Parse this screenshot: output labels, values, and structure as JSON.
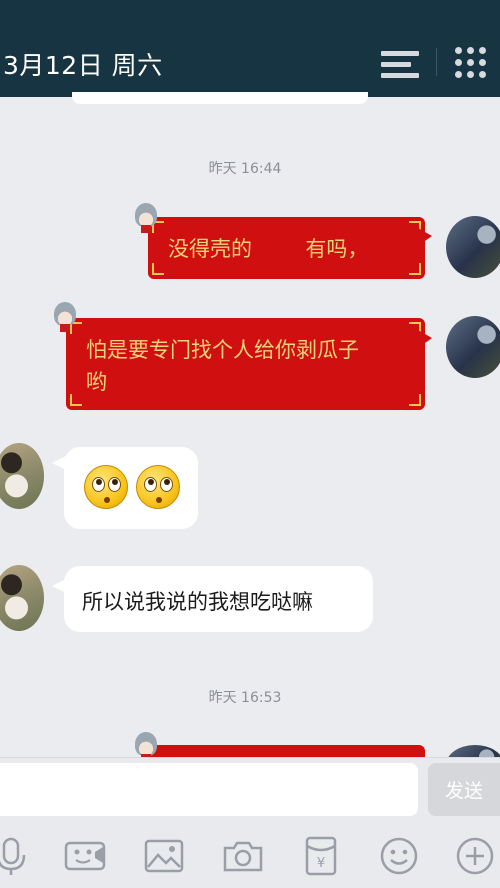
{
  "header": {
    "title": "3月12日  周六"
  },
  "chat": {
    "messages": [
      {
        "type": "timestamp",
        "text": "昨天 16:44"
      },
      {
        "type": "outgoing_redpacket",
        "text": "没得壳的        有吗，"
      },
      {
        "type": "outgoing_redpacket",
        "line1": "怕是要专门找个人给你剥瓜子",
        "line2": "哟"
      },
      {
        "type": "incoming_emoji",
        "emojis": [
          "rolling-eyes-emoji",
          "rolling-eyes-emoji"
        ]
      },
      {
        "type": "incoming_text",
        "text": "所以说我说的我想吃哒嘛"
      },
      {
        "type": "timestamp",
        "text": "昨天 16:53"
      }
    ]
  },
  "composer": {
    "input_value": "",
    "send_label": "发送"
  },
  "toolbar": {
    "items": [
      "microphone-icon",
      "video-icon",
      "image-icon",
      "camera-icon",
      "red-packet-icon",
      "emoji-icon",
      "plus-icon"
    ]
  },
  "colors": {
    "header_bg": "#163441",
    "chat_bg": "#ebecf0",
    "redpacket_bg": "#d01010",
    "redpacket_text": "#f2d27a",
    "icon_color": "#9a9ea6"
  }
}
